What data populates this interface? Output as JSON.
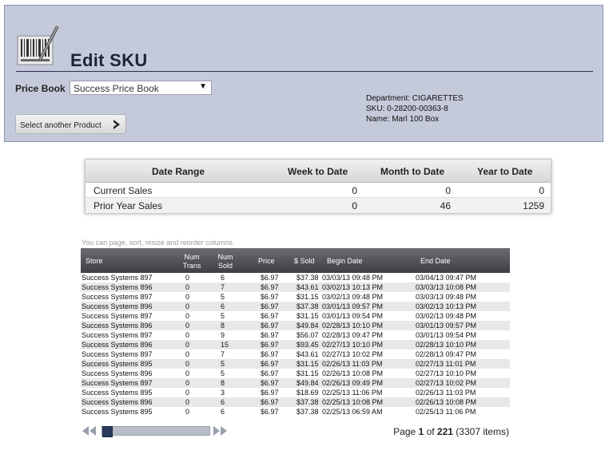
{
  "header": {
    "title": "Edit SKU",
    "price_book_label": "Price Book",
    "price_book_value": "Success Price Book",
    "select_product_label": "Select another Product"
  },
  "sku_info": {
    "department": "Department: CIGARETTES",
    "sku": "SKU: 0-28200-00363-8",
    "name": "Name: Marl 100 Box"
  },
  "sales_summary": {
    "headers": [
      "Date Range",
      "Week to Date",
      "Month to Date",
      "Year to Date"
    ],
    "rows": [
      {
        "label": "Current Sales",
        "week": "0",
        "month": "0",
        "year": "0"
      },
      {
        "label": "Prior Year Sales",
        "week": "0",
        "month": "46",
        "year": "1259"
      }
    ]
  },
  "grid": {
    "hint": "You can page, sort, resize and reorder columns.",
    "headers": {
      "store": "Store",
      "num_trans_1": "Num",
      "num_trans_2": "Trans",
      "num_sold_1": "Num",
      "num_sold_2": "Sold",
      "price": "Price",
      "sold": "$ Sold",
      "begin": "Begin Date",
      "end": "End Date"
    },
    "rows": [
      {
        "store": "Success Systems 897",
        "trans": "0",
        "sold": "6",
        "price": "$6.97",
        "amount": "$37.38",
        "begin": "03/03/13 09:48 PM",
        "end": "03/04/13 09:47 PM"
      },
      {
        "store": "Success Systems 896",
        "trans": "0",
        "sold": "7",
        "price": "$6.97",
        "amount": "$43.61",
        "begin": "03/02/13 10:13 PM",
        "end": "03/03/13 10:08 PM"
      },
      {
        "store": "Success Systems 897",
        "trans": "0",
        "sold": "5",
        "price": "$6.97",
        "amount": "$31.15",
        "begin": "03/02/13 09:48 PM",
        "end": "03/03/13 09:48 PM"
      },
      {
        "store": "Success Systems 896",
        "trans": "0",
        "sold": "6",
        "price": "$6.97",
        "amount": "$37.38",
        "begin": "03/01/13 09:57 PM",
        "end": "03/02/13 10:13 PM"
      },
      {
        "store": "Success Systems 897",
        "trans": "0",
        "sold": "5",
        "price": "$6.97",
        "amount": "$31.15",
        "begin": "03/01/13 09:54 PM",
        "end": "03/02/13 09:48 PM"
      },
      {
        "store": "Success Systems 896",
        "trans": "0",
        "sold": "8",
        "price": "$6.97",
        "amount": "$49.84",
        "begin": "02/28/13 10:10 PM",
        "end": "03/01/13 09:57 PM"
      },
      {
        "store": "Success Systems 897",
        "trans": "0",
        "sold": "9",
        "price": "$6.97",
        "amount": "$56.07",
        "begin": "02/28/13 09:47 PM",
        "end": "03/01/13 09:54 PM"
      },
      {
        "store": "Success Systems 896",
        "trans": "0",
        "sold": "15",
        "price": "$6.97",
        "amount": "$93.45",
        "begin": "02/27/13 10:10 PM",
        "end": "02/28/13 10:10 PM"
      },
      {
        "store": "Success Systems 897",
        "trans": "0",
        "sold": "7",
        "price": "$6.97",
        "amount": "$43.61",
        "begin": "02/27/13 10:02 PM",
        "end": "02/28/13 09:47 PM"
      },
      {
        "store": "Success Systems 895",
        "trans": "0",
        "sold": "5",
        "price": "$6.97",
        "amount": "$31.15",
        "begin": "02/26/13 11:03 PM",
        "end": "02/27/13 11:01 PM"
      },
      {
        "store": "Success Systems 896",
        "trans": "0",
        "sold": "5",
        "price": "$6.97",
        "amount": "$31.15",
        "begin": "02/26/13 10:08 PM",
        "end": "02/27/13 10:10 PM"
      },
      {
        "store": "Success Systems 897",
        "trans": "0",
        "sold": "8",
        "price": "$6.97",
        "amount": "$49.84",
        "begin": "02/26/13 09:49 PM",
        "end": "02/27/13 10:02 PM"
      },
      {
        "store": "Success Systems 895",
        "trans": "0",
        "sold": "3",
        "price": "$6.97",
        "amount": "$18.69",
        "begin": "02/25/13 11:06 PM",
        "end": "02/26/13 11:03 PM"
      },
      {
        "store": "Success Systems 896",
        "trans": "0",
        "sold": "6",
        "price": "$6.97",
        "amount": "$37.38",
        "begin": "02/25/13 10:08 PM",
        "end": "02/26/13 10:08 PM"
      },
      {
        "store": "Success Systems 895",
        "trans": "0",
        "sold": "6",
        "price": "$6.97",
        "amount": "$37.38",
        "begin": "02/25/13 06:59 AM",
        "end": "02/25/13 11:06 PM"
      }
    ]
  },
  "pager": {
    "page_word": "Page",
    "current": "1",
    "of_word": "of",
    "total": "221",
    "items": "(3307 items)",
    "scroll_position": 0
  }
}
